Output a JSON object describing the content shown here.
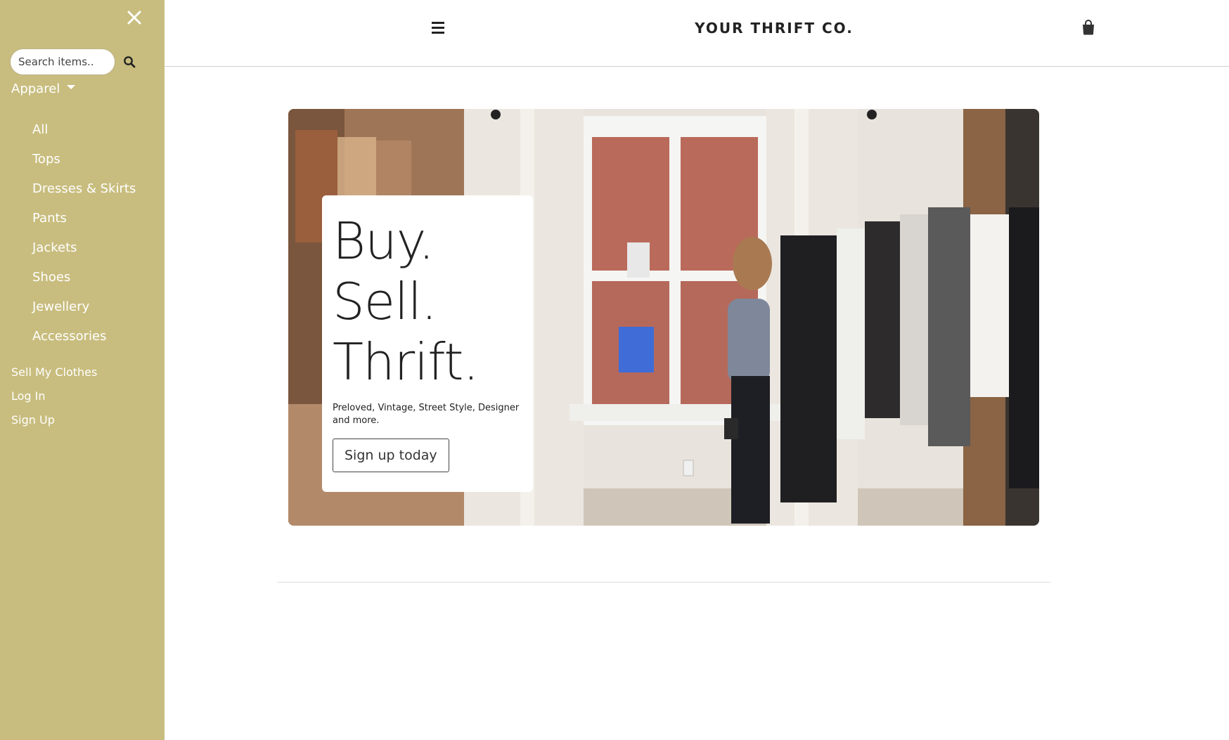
{
  "colors": {
    "sidebar_bg": "#c8bd7e",
    "sidebar_text": "#ffffff",
    "header_text": "#222222"
  },
  "sidebar": {
    "close_icon": "close-icon",
    "search": {
      "placeholder": "Search items..",
      "icon": "search-icon"
    },
    "apparel_label": "Apparel",
    "categories": [
      {
        "label": "All"
      },
      {
        "label": "Tops"
      },
      {
        "label": "Dresses & Skirts"
      },
      {
        "label": "Pants"
      },
      {
        "label": "Jackets"
      },
      {
        "label": "Shoes"
      },
      {
        "label": "Jewellery"
      },
      {
        "label": "Accessories"
      }
    ],
    "account_links": [
      {
        "label": "Sell My Clothes"
      },
      {
        "label": "Log In"
      },
      {
        "label": "Sign Up"
      }
    ]
  },
  "header": {
    "menu_icon": "hamburger-menu-icon",
    "brand": "YOUR THRIFT CO.",
    "cart_icon": "shopping-bag-icon"
  },
  "hero": {
    "headline_line1": "Buy.",
    "headline_line2": "Sell.",
    "headline_line3": "Thrift.",
    "subtitle": "Preloved, Vintage, Street Style, Designer and more.",
    "cta_label": "Sign up today"
  }
}
